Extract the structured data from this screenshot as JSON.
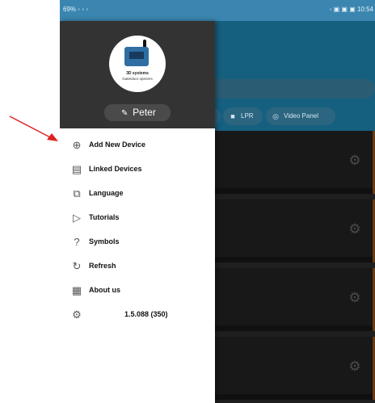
{
  "status_bar": {
    "left": "69% ◦ ◦ ◦",
    "right": "◦ ▣ ▣ ▣ 10:54"
  },
  "background_app": {
    "chips": [
      {
        "label": "LPR",
        "icon": "video-camera-icon"
      },
      {
        "label": "Video Panel",
        "icon": "camera-lens-icon"
      }
    ],
    "rows": 4
  },
  "drawer": {
    "logo": {
      "brand": "3D systems",
      "tagline": "Gate/door openers"
    },
    "user_name": "Peter",
    "menu": [
      {
        "label": "Add New Device",
        "icon": "add-circle-icon"
      },
      {
        "label": "Linked Devices",
        "icon": "linked-devices-icon"
      },
      {
        "label": "Language",
        "icon": "language-icon"
      },
      {
        "label": "Tutorials",
        "icon": "tutorials-icon"
      },
      {
        "label": "Symbols",
        "icon": "help-circle-icon"
      },
      {
        "label": "Refresh",
        "icon": "refresh-icon"
      },
      {
        "label": "About us",
        "icon": "about-document-icon"
      }
    ],
    "version": "1.5.088 (350)",
    "version_icon": "settings-gear-icon"
  },
  "colors": {
    "header_blue": "#16607f",
    "status_bar": "#3a86b0",
    "drawer_header": "#333333",
    "arrow": "#e02020"
  }
}
